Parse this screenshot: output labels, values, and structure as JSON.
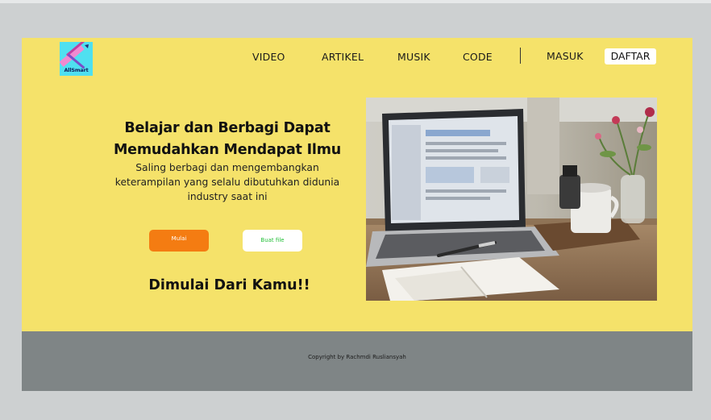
{
  "brand": {
    "logo_text": "AllSmart"
  },
  "nav": {
    "items": [
      "VIDEO",
      "ARTIKEL",
      "MUSIK",
      "CODE"
    ],
    "login_label": "MASUK",
    "register_label": "DAFTAR"
  },
  "hero": {
    "headline_line1": "Belajar dan Berbagi Dapat",
    "headline_line2": "Memudahkan Mendapat Ilmu",
    "subtext_line1": "Saling berbagi dan mengembangkan",
    "subtext_line2": "keterampilan yang selalu dibutuhkan didunia",
    "subtext_line3": "industry saat ini",
    "primary_button": "Mulai",
    "secondary_button": "Buat file",
    "tagline": "Dimulai Dari Kamu!!"
  },
  "footer": {
    "copyright": "Copyright by Rachmdi Rusliansyah"
  },
  "colors": {
    "page_background": "#f5e26a",
    "footer_background": "#7f8586",
    "primary_button": "#f47c12",
    "secondary_button_text": "#26c03a",
    "logo_background": "#4fe0f0"
  }
}
